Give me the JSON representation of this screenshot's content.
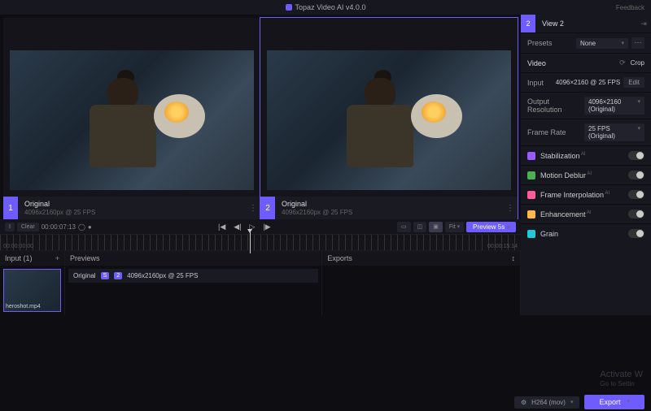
{
  "titlebar": {
    "app": "Topaz Video AI  v4.0.0",
    "feedback": "Feedback"
  },
  "views": [
    {
      "num": "1",
      "name": "Original",
      "meta": "4096x2160px @ 25 FPS"
    },
    {
      "num": "2",
      "name": "Original",
      "meta": "4096x2160px @ 25 FPS"
    }
  ],
  "sidebar": {
    "num": "2",
    "title": "View 2",
    "presets_label": "Presets",
    "presets_value": "None",
    "video_label": "Video",
    "crop_label": "Crop",
    "input_label": "Input",
    "input_value": "4096×2160 @ 25 FPS",
    "edit_btn": "Edit",
    "outres_label": "Output Resolution",
    "outres_value": "4096×2160 (Original)",
    "fps_label": "Frame Rate",
    "fps_value": "25 FPS (Original)",
    "enhancements": [
      {
        "label": "Stabilization",
        "ai": true,
        "color": "#9b5cff"
      },
      {
        "label": "Motion Deblur",
        "ai": true,
        "color": "#4caf50"
      },
      {
        "label": "Frame Interpolation",
        "ai": true,
        "color": "#ff5c9b"
      },
      {
        "label": "Enhancement",
        "ai": true,
        "color": "#ffb74d"
      },
      {
        "label": "Grain",
        "ai": false,
        "color": "#26c6da"
      }
    ]
  },
  "timeline": {
    "trim": "I",
    "clear": "Clear",
    "timecode": "00:00:07:13",
    "start": "00:00:00:00",
    "end": "00:00:15:14",
    "fit": "Fit",
    "preview": "Preview 5s"
  },
  "bottom": {
    "input_label": "Input (1)",
    "thumb_name": "heroshot.mp4",
    "previews_label": "Previews",
    "preview_item_name": "Original",
    "preview_item_badge1": "S",
    "preview_item_badge2": "2",
    "preview_item_meta": "4096x2160px @ 25 FPS",
    "exports_label": "Exports"
  },
  "footer": {
    "codec": "H264 (mov)",
    "export": "Export"
  },
  "watermark": {
    "l1": "Activate W",
    "l2": "Go to Settin"
  }
}
